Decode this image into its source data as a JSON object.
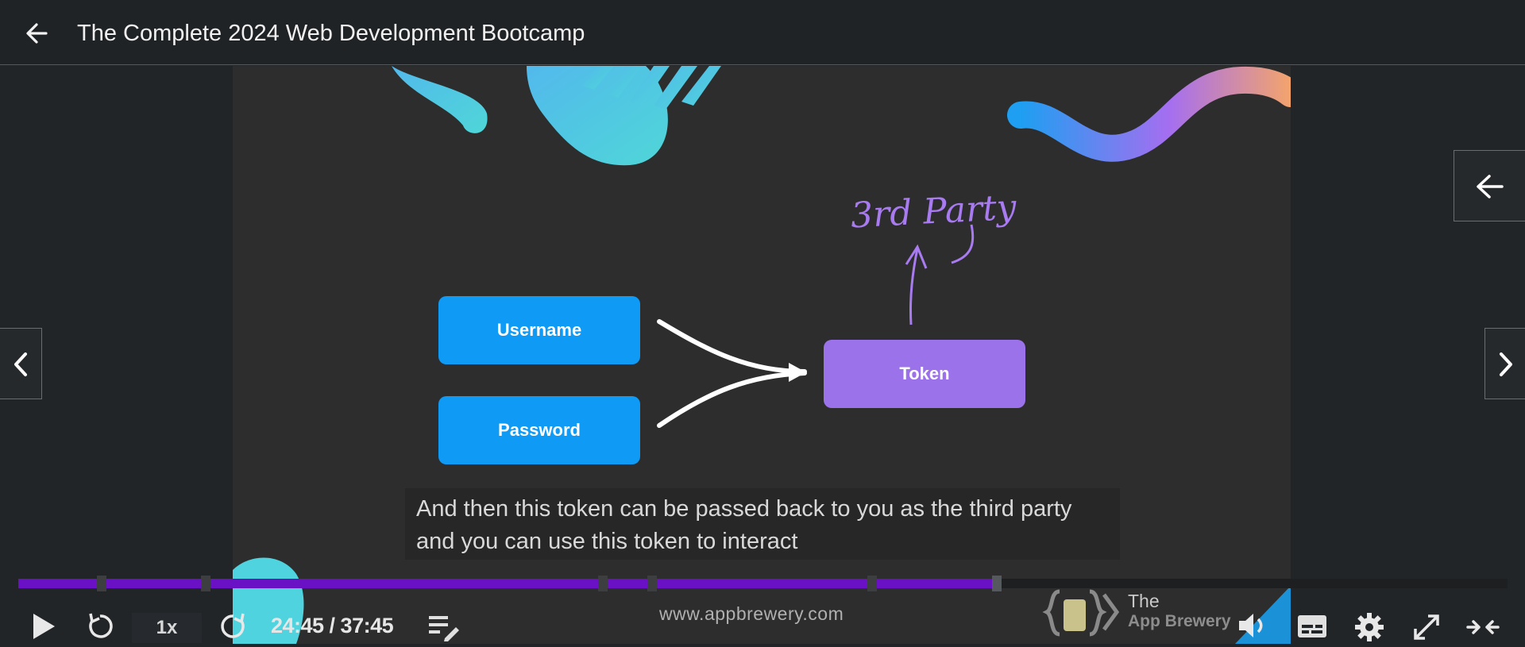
{
  "header": {
    "course_title": "The Complete 2024 Web Development Bootcamp"
  },
  "slide": {
    "username_label": "Username",
    "password_label": "Password",
    "token_label": "Token",
    "handwritten_note": "3rd Party",
    "colors": {
      "blue_box": "#0f9af5",
      "purple_box": "#9b72ea",
      "progress": "#6a11c5"
    }
  },
  "caption": {
    "line1": "And then this token can be passed back to you as the third party",
    "line2": "and you can use this token to interact"
  },
  "player": {
    "speed_label": "1x",
    "time_display": "24:45 / 37:45",
    "progress_fraction": 0.658,
    "website": "www.appbrewery.com",
    "brand_the": "The",
    "brand_name": "App Brewery"
  },
  "icons": [
    "back-arrow-icon",
    "chevron-left-icon",
    "chevron-right-icon",
    "play-icon",
    "rewind-icon",
    "forward-icon",
    "notes-icon",
    "volume-icon",
    "captions-icon",
    "settings-icon",
    "fullscreen-icon",
    "collapse-icon"
  ]
}
